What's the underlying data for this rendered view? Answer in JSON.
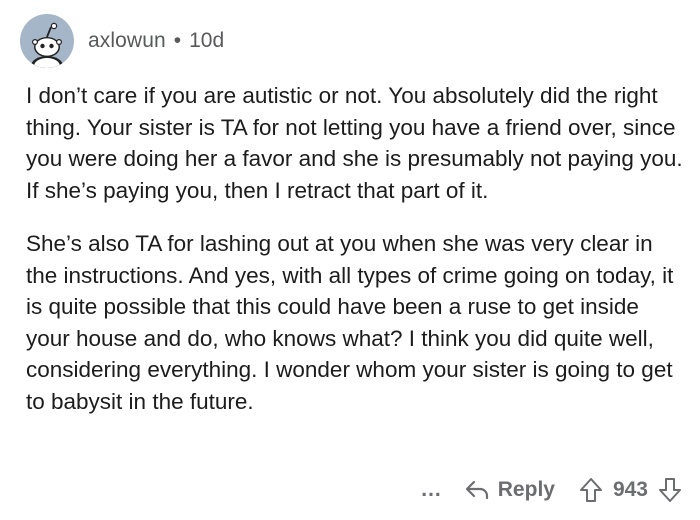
{
  "comment": {
    "username": "axlowun",
    "separator": "•",
    "age": "10d",
    "paragraphs": [
      "I don’t care if you are autistic or not. You absolutely did the right thing. Your sister is TA for not letting you have a friend over, since you were doing her a favor and she is presumably not paying you. If she’s paying you, then I retract that part of it.",
      "She’s also TA for lashing out at you when she was very clear in the instructions. And yes, with all types of crime going on today, it is quite possible that this could have been a ruse to get inside your house and do, who knows what?  I think you did quite well, considering everything.  I wonder whom your sister is going to get to babysit in the future."
    ]
  },
  "actions": {
    "more_label": "...",
    "reply_label": "Reply",
    "score": "943"
  },
  "colors": {
    "avatar_bg": "#a4b6c8",
    "meta_text": "#57595b",
    "body_text": "#1c1c1c"
  },
  "icons": {
    "avatar": "reddit-snoo-avatar",
    "reply": "reply-arrow-icon",
    "upvote": "upvote-arrow-icon",
    "downvote": "downvote-arrow-icon"
  }
}
